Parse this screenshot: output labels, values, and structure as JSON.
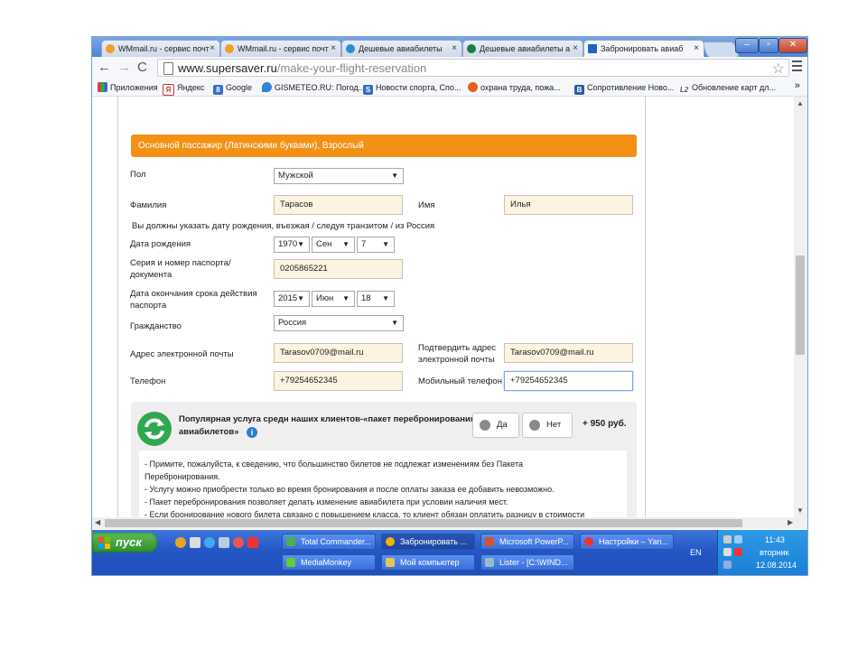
{
  "window": {
    "controls": {
      "min": "–",
      "max": "▫",
      "close": "✕"
    }
  },
  "tabs": [
    {
      "label": "WMmail.ru - сервис почт",
      "close": "×"
    },
    {
      "label": "WMmail.ru - сервис почт",
      "close": "×"
    },
    {
      "label": "Дешевые авиабилеты",
      "close": "×"
    },
    {
      "label": "Дешевые авиабилеты а",
      "close": "×"
    },
    {
      "label": "Забронировать авиаб",
      "close": "×"
    }
  ],
  "address": {
    "domain": "www.supersaver.ru",
    "path": "/make-your-flight-reservation"
  },
  "bookmarks": [
    {
      "label": "Приложения",
      "icon": "apps-icon"
    },
    {
      "label": "Яндекс",
      "icon": "yandex-icon"
    },
    {
      "label": "Google",
      "icon": "google-icon"
    },
    {
      "label": "GISMETEO.RU: Погод...",
      "icon": "gismeteo-icon"
    },
    {
      "label": "Новости спорта, Спо...",
      "icon": "sports-icon"
    },
    {
      "label": "охрана труда, пожа...",
      "icon": "safety-icon"
    },
    {
      "label": "Сопротивление Ново...",
      "icon": "b-icon"
    },
    {
      "label": "Обновление карт дл...",
      "icon": "l2-icon"
    }
  ],
  "bookmarks_more": "»",
  "form": {
    "section_title": "Основной пассажир (Латинскими буквами), Взрослый",
    "gender_label": "Пол",
    "gender_value": "Мужской",
    "surname_label": "Фамилия",
    "surname_value": "Тарасов",
    "name_label": "Имя",
    "name_value": "Илья",
    "dob_notice": "Вы должны указать дату рождения, въезжая / следуя транзитом / из Россия",
    "dob_label": "Дата рождения",
    "dob_year": "1970",
    "dob_month": "Сен",
    "dob_day": "7",
    "passport_label": "Серия и номер паспорта/ документа",
    "passport_value": "0205865221",
    "expiry_label": "Дата окончания срока действия паспорта",
    "exp_year": "2015",
    "exp_month": "Июн",
    "exp_day": "18",
    "citizenship_label": "Гражданство",
    "citizenship_value": "Россия",
    "email_label": "Адрес электронной почты",
    "email_value": "Tarasov0709@mail.ru",
    "email_confirm_label": "Подтвердить адрес электронной почты",
    "email_confirm_value": "Tarasov0709@mail.ru",
    "phone_label": "Телефон",
    "phone_value": "+79254652345",
    "mobile_label": "Мобильный телефон",
    "mobile_value": "+79254652345"
  },
  "service": {
    "title": "Популярная услуга средн наших клиентов-«пакет перебронирования авиабилетов»",
    "info_glyph": "i",
    "yes": "Да",
    "no": "Нет",
    "price": "+ 950 руб.",
    "lines": [
      "- Примите, пожалуйста, к сведению, что большинство билетов не подлежат изменениям без Пакета",
      "Перебронирования.",
      "- Услугу можно приобрести только во время бронирования и после оплаты заказа ее добавить невозможно.",
      "- Пакет перебронирования позволяет делать изменение авиабилета при условии наличия мест.",
      "- Если бронирование нового билета связано с повышением класса, то клиент обязан оплатить разницу в стоимости"
    ]
  },
  "taskbar": {
    "start_label": "пуск",
    "row1": [
      {
        "label": "Total Commander...",
        "icon": "tc-icon"
      },
      {
        "label": "Забронировать ...",
        "icon": "chrome-icon"
      },
      {
        "label": "Microsoft PowerP...",
        "icon": "ppt-icon"
      },
      {
        "label": "Настройки – Yan...",
        "icon": "yandex-browser-icon"
      }
    ],
    "row2": [
      {
        "label": "MediaMonkey",
        "icon": "mediamonkey-icon"
      },
      {
        "label": "Мой компьютер",
        "icon": "computer-icon"
      },
      {
        "label": "Lister - [C:\\WIND...",
        "icon": "lister-icon"
      }
    ],
    "lang": "EN",
    "time": "11:43",
    "day": "вторник",
    "date": "12.08.2014"
  },
  "colors": {
    "section_header": "#f39117",
    "service_green": "#2fa84f",
    "input_bg": "#fdf3e1",
    "xp_taskbar": "#2b5fd0",
    "xp_start": "#3a9b37"
  }
}
